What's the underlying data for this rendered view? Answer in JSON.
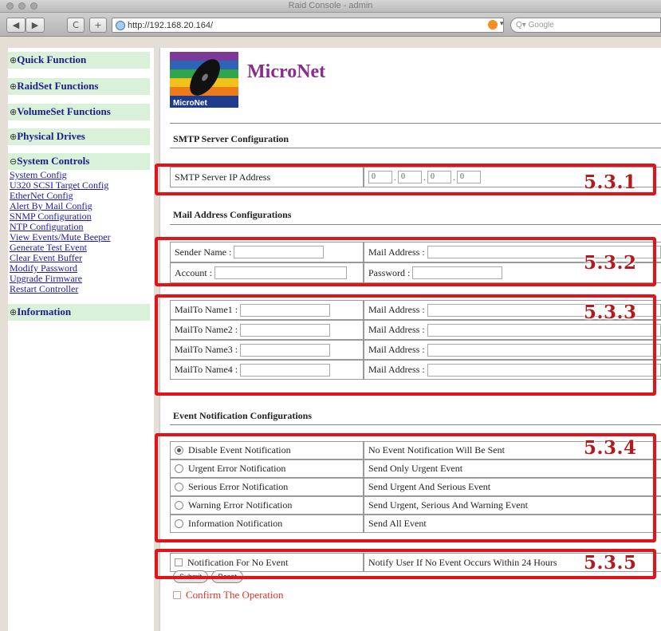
{
  "browser": {
    "window_title": "Raid Console - admin",
    "back_label": "◀",
    "forward_label": "▶",
    "reload_label": "C",
    "add_label": "+",
    "url": "http://192.168.20.164/",
    "search_placeholder": "Q▾ Google"
  },
  "sidebar": {
    "quick_function": "Quick Function",
    "raidset_functions": "RaidSet Functions",
    "volumeset_functions": "VolumeSet Functions",
    "physical_drives": "Physical Drives",
    "system_controls": "System Controls",
    "links": [
      "System Config",
      "U320 SCSI Target Config",
      "EtherNet Config",
      "Alert By Mail Config",
      "SNMP Configuration",
      "NTP Configuration",
      "View Events/Mute Beeper",
      "Generate Test Event",
      "Clear Event Buffer",
      "Modify Password",
      "Upgrade Firmware",
      "Restart Controller"
    ],
    "information": "Information",
    "expand_glyph": "⊕",
    "collapse_glyph": "⊖"
  },
  "header": {
    "brand": "MicroNet",
    "logo_caption": "MicroNet"
  },
  "smtp": {
    "section_title": "SMTP Server Configuration",
    "ip_label": "SMTP Server IP Address",
    "ip": [
      "0",
      "0",
      "0",
      "0"
    ]
  },
  "mail": {
    "section_title": "Mail Address Configurations",
    "sender_name_label": "Sender Name :",
    "mail_address_label": "Mail Address :",
    "account_label": "Account :",
    "password_label": "Password :",
    "mailto": [
      {
        "name_label": "MailTo Name1 :",
        "address_label": "Mail Address :"
      },
      {
        "name_label": "MailTo Name2 :",
        "address_label": "Mail Address :"
      },
      {
        "name_label": "MailTo Name3 :",
        "address_label": "Mail Address :"
      },
      {
        "name_label": "MailTo Name4 :",
        "address_label": "Mail Address :"
      }
    ]
  },
  "events": {
    "section_title": "Event Notification Configurations",
    "options": [
      {
        "label": "Disable Event Notification",
        "desc": "No Event Notification Will Be Sent",
        "selected": true
      },
      {
        "label": "Urgent Error Notification",
        "desc": "Send Only Urgent Event",
        "selected": false
      },
      {
        "label": "Serious Error Notification",
        "desc": "Send Urgent And Serious Event",
        "selected": false
      },
      {
        "label": "Warning Error Notification",
        "desc": "Send Urgent, Serious And Warning Event",
        "selected": false
      },
      {
        "label": "Information Notification",
        "desc": "Send All Event",
        "selected": false
      }
    ],
    "no_event_label": "Notification For No Event",
    "no_event_desc": "Notify User If No Event Occurs Within 24 Hours"
  },
  "confirm_label": "Confirm The Operation",
  "submit_label": "Submit",
  "reset_label": "Reset",
  "annotations": [
    "5.3.1",
    "5.3.2",
    "5.3.3",
    "5.3.4",
    "5.3.5"
  ],
  "colors": {
    "annotation_red": "#e2141b",
    "annotation_text": "#b21b1e",
    "sidebar_head_bg": "#d9f1d9",
    "link_blue": "#1a1aa6",
    "brand_purple": "#8a2c8c",
    "confirm_red": "#e3342a"
  }
}
